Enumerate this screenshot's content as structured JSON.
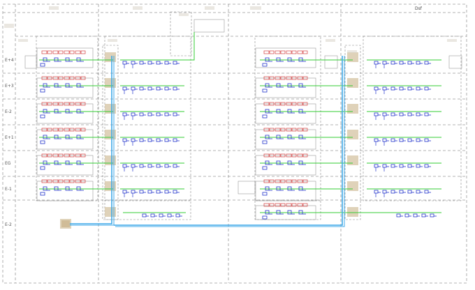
{
  "diagram": {
    "top_right_label": "Dsf",
    "levels": [
      "E+4",
      "E+3",
      "E-2",
      "E+1",
      "EG",
      "E-1",
      "E-2"
    ],
    "colors": {
      "green_line": "#33cc33",
      "blue_pipe": "#3fa9e8",
      "device_blue": "#2233cc",
      "device_red": "#d23b3b",
      "frame": "#9a9a9a",
      "shaft": "#d8c3a0"
    }
  }
}
